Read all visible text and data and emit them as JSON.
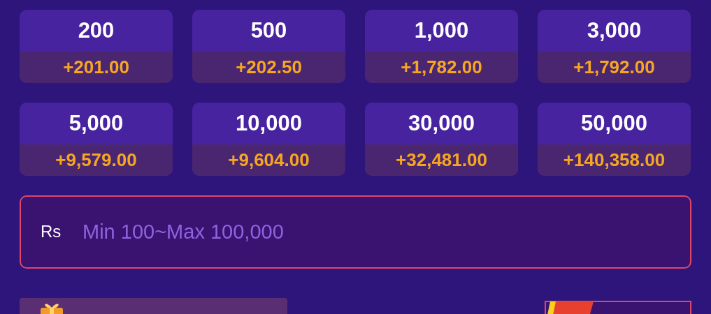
{
  "amounts": [
    {
      "amount": "200",
      "bonus": "+201.00"
    },
    {
      "amount": "500",
      "bonus": "+202.50"
    },
    {
      "amount": "1,000",
      "bonus": "+1,782.00"
    },
    {
      "amount": "3,000",
      "bonus": "+1,792.00"
    },
    {
      "amount": "5,000",
      "bonus": "+9,579.00"
    },
    {
      "amount": "10,000",
      "bonus": "+9,604.00"
    },
    {
      "amount": "30,000",
      "bonus": "+32,481.00"
    },
    {
      "amount": "50,000",
      "bonus": "+140,358.00"
    }
  ],
  "amount_field": {
    "currency": "Rs",
    "placeholder": "Min 100~Max 100,000"
  }
}
